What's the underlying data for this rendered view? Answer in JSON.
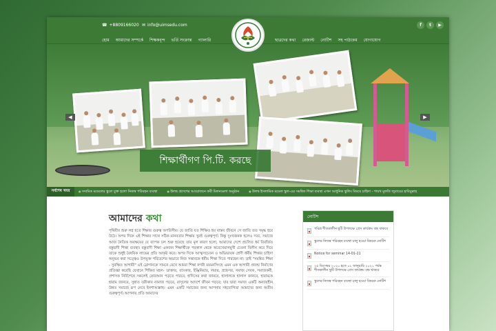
{
  "contact": {
    "phone": "+8809166020",
    "email": "info@uimsedu.com"
  },
  "social": [
    "f",
    "t",
    "▶"
  ],
  "nav": {
    "left": [
      "হোম",
      "আমাদের সম্পর্কে",
      "শিক্ষকবৃন্দ",
      "ভর্তি সংক্রান্ত",
      "গ্যালারি"
    ],
    "right": [
      "ছাত্রদের কথা",
      "রেজাল্ট",
      "নোটিশ",
      "সহ পাঠ্যক্রম",
      "যোগাযোগ"
    ]
  },
  "hero": {
    "caption": "শিক্ষার্থীগণ পি.টি. করছে",
    "prev": "◀",
    "next": "▶"
  },
  "ticker": {
    "label": "সর্বশেষ খবর",
    "items": [
      "সদ্যমিক মডেলের স্কুলে যুক্ত হলো নিজস্ব পরিবহন ব্যবস্থা",
      "উলদ্ব প্রদেশের আয়োজনে কবী মিলনমেলা অনুষ্ঠান",
      "উলদ্ব ইসলামিক মডেল স্কুল-এর সমন্বিত শিক্ষা ব্যবস্থা এখন আধুনিক স্কুলিং বিষয়ে চাহিদা - শায়খ মুফতি জুবায়ের হাবিবুল্লাহ"
    ]
  },
  "about": {
    "title_plain": "আমাদের ",
    "title_accent": "কথা",
    "body": "পৃথিবীর শুরু লগ্ন হতে শিক্ষার গুরুত্ব অপরিসীম। যে জাতি যত শিক্ষিত হয় বাস্তব জীবনে সে জাতি তত সমৃদ্ধ হয়ে উঠে। অপর দিকে এই শিক্ষার সাথে সঠিক মানবতার শিক্ষায় খুবই গুরুত্বপূর্ণ। কিন্তু দুঃখজনক হলেও সত্য, সমাজে আজ নৈতিক অবক্ষয়ের যে ব্যাপক ঢল শুরু হয়েছে তার মূল কারণ হলো, আমাদের দেশে প্রচলিত ধর্ম বিবর্জিত বস্তুবাদী শিক্ষা ব্যবস্থা। বস্তুবাদী শিক্ষা একজন শিক্ষার্থীকে পরকাল থেকে অবেখেয়ালমুখী চেতনা বিলীন করে দিয়ে তাকে শুধুই বৈষয়িক লাভের প্রতি আকৃষ্ট করে। অপর দিকে আত্মসচেতন ও অভিভাবক শ্রেণী ধর্মীয় শিক্ষার চাহিদা অনুভব করা সত্ত্বেও উপযুক্ত পরিবেশের অভাবে নিজ সন্তানকে ধর্মীয় শিক্ষা দিতে পারছেন না। তাই \"সমন্বিত শিক্ষা - সুরক্ষিত আগামী\" এই স্লোগানকে সামনে রেখে আমরা শিক্ষা নগরী ময়মনসিংহে এমন এক আগামী প্রজন্ম নির্মাণের প্রতিজ্ঞা করেছি যেখানে শিক্ষিত মহল- ডাক্তার, ব্যাংকার, ইঞ্জিনিয়ার, লয়ার, প্রফেসর, সমাজ সেবক, সমাজকর্মী, প্রশাসক নির্বিশেষে সকলেই কোরআন পড়তে পারবে, হাদিসের কথা জানবে, হালালকে হালাল জানবে, হারামকে হারাম জানবে, সুন্নাত তরীকায় নামাজ পড়বে, রাসূলের আদর্শে জীবন গড়বে; যার দ্বারা সমাজ একটি অন্যায়হীন উন্নত সমাজে রূপ নেবে ইনশাআল্লাহ। এমন একটি সমাজের জন্য আপনার সহযোগিতা আমাদের জন্য অতীব গুরুত্বপূর্ণ। আপনার প্রতি আমাদের"
  },
  "notice": {
    "title": "নোটিশ",
    "items": [
      "পবিত্র শীতকালীন ছুটি উপলক্ষে প্রেস কার্যক্রম বন্ধ থাকবে",
      "স্কুলের নিজস্ব পরিবহন ব্যবস্থা চালু হওয়া বিষয়ক নোটিশ",
      "Notice for seminar 14-01-21",
      "২৫ ডিসেম্বর ২০২০ হতে ০১ জানুয়ারি ২০২১ পর্যন্ত শীতকালীন ছুটি উপলক্ষে প্রেস কার্যক্রম বন্ধ থাকবে",
      "স্কুলের নিজস্ব পরিবহন ব্যবস্থা চালু হওয়া বিষয়ক নোটিশ"
    ]
  },
  "colors": {
    "primary_green": "#3c7a35",
    "accent_green": "#3c8a38"
  }
}
